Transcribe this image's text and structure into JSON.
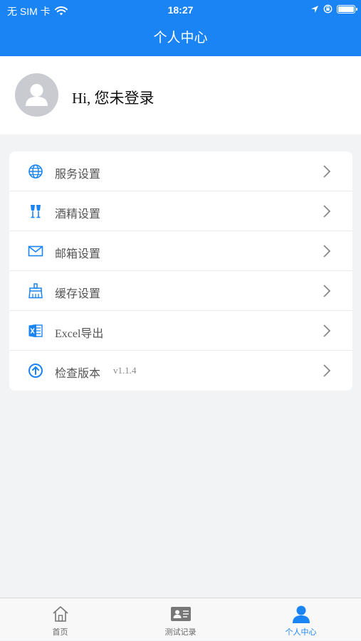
{
  "status_bar": {
    "carrier": "无 SIM 卡",
    "time": "18:27"
  },
  "nav": {
    "title": "个人中心"
  },
  "profile": {
    "greeting": "Hi, 您未登录"
  },
  "menu": {
    "items": [
      {
        "label": "服务设置",
        "icon": "globe-icon"
      },
      {
        "label": "酒精设置",
        "icon": "wine-glass-icon"
      },
      {
        "label": "邮箱设置",
        "icon": "mail-icon"
      },
      {
        "label": "缓存设置",
        "icon": "broom-icon"
      },
      {
        "label": "Excel导出",
        "icon": "excel-icon"
      },
      {
        "label": "检查版本",
        "icon": "upload-circle-icon",
        "version": "v1.1.4"
      }
    ]
  },
  "tabbar": {
    "tabs": [
      {
        "label": "首页",
        "icon": "home-icon"
      },
      {
        "label": "测试记录",
        "icon": "id-card-icon"
      },
      {
        "label": "个人中心",
        "icon": "person-icon",
        "active": true
      }
    ]
  },
  "colors": {
    "accent": "#1a84f5",
    "background": "#f2f3f5",
    "icon_blue": "#1a84f5"
  }
}
